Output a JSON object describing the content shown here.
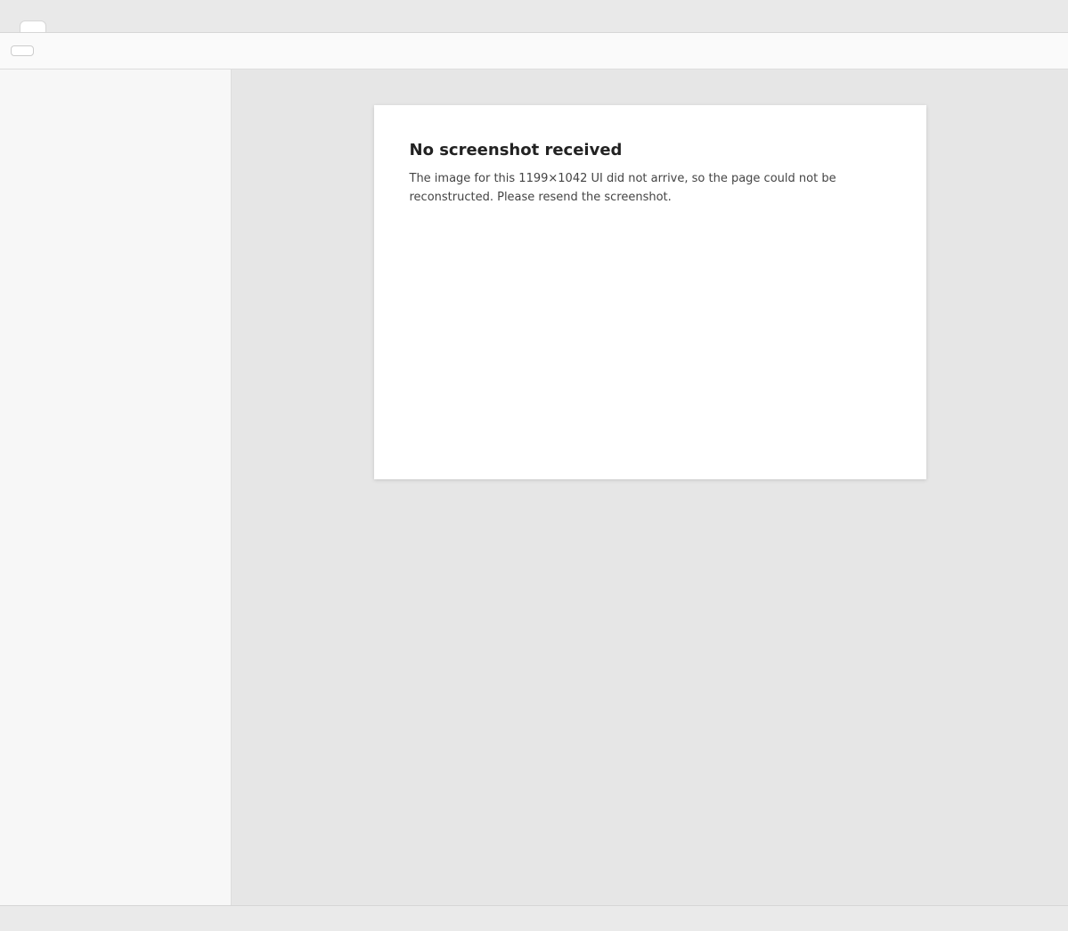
{
  "window": {
    "app_name": "",
    "tab_label": ""
  },
  "toolbar": {
    "primary_label": ""
  },
  "sidebar": {
    "heading": ""
  },
  "notice": {
    "title": "No screenshot received",
    "body": "The image for this 1199×1042 UI did not arrive, so the page could not be reconstructed. Please resend the screenshot."
  },
  "status": {
    "text": ""
  }
}
